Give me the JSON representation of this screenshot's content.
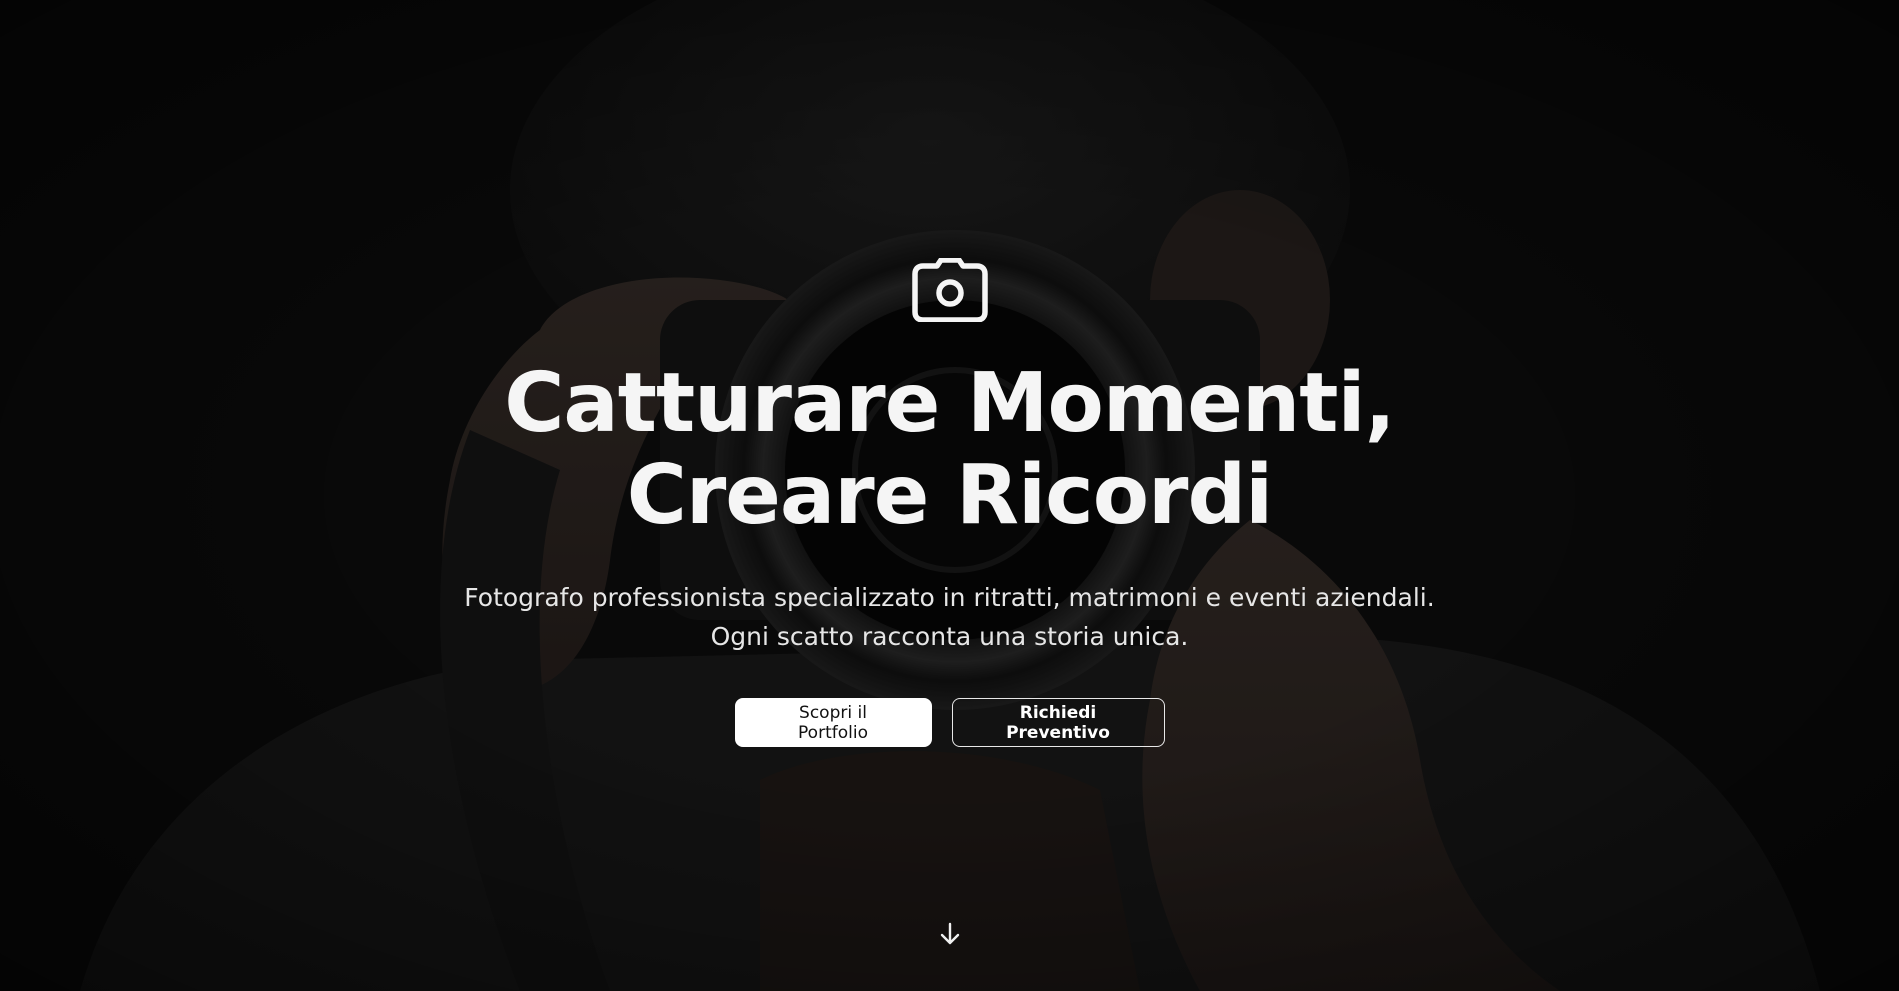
{
  "hero": {
    "background_image": "photographer-holding-camera-dark-photo",
    "icon": "camera-icon",
    "headline": {
      "line1": "Catturare Momenti,",
      "line2": "Creare Ricordi"
    },
    "subtitle": {
      "line1": "Fotografo professionista specializzato in ritratti, matrimoni e eventi aziendali.",
      "line2": "Ogni scatto racconta una storia unica."
    },
    "buttons": {
      "primary_label": "Scopri il Portfolio",
      "secondary_label": "Richiedi Preventivo"
    },
    "scroll_icon": "arrow-down-icon"
  },
  "colors": {
    "text": "#f5f5f5",
    "primary_button_bg": "#ffffff",
    "primary_button_text": "#111111",
    "secondary_button_border": "#e8e8e8"
  }
}
